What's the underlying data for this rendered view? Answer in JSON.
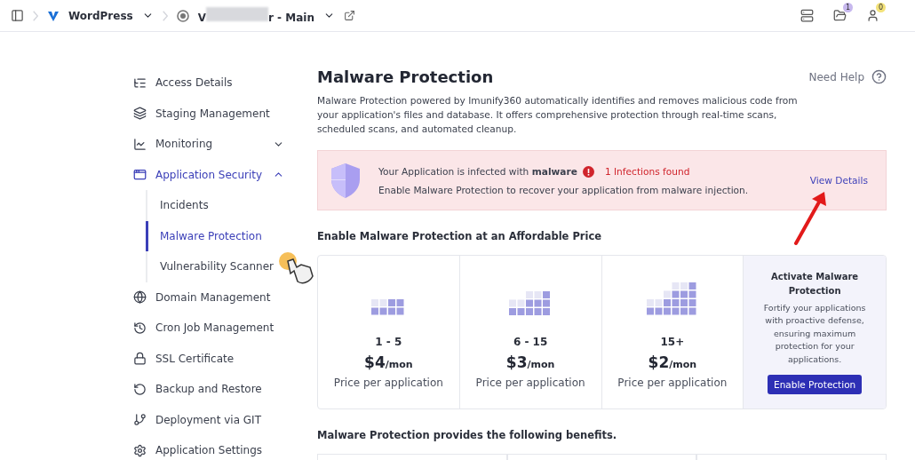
{
  "topbar": {
    "breadcrumbs": [
      {
        "label": "WordPress"
      },
      {
        "label_start": "V",
        "label_end": "r - Main"
      }
    ],
    "notifications": [
      {
        "count": "1",
        "color": "#c7b8ee"
      },
      {
        "count": "0",
        "color": "#f3e27a"
      }
    ]
  },
  "sidebar": {
    "items": [
      {
        "label": "Access Details",
        "kind": "item"
      },
      {
        "label": "Staging Management",
        "kind": "item"
      },
      {
        "label": "Monitoring",
        "kind": "group",
        "expanded": false
      },
      {
        "label": "Application Security",
        "kind": "group",
        "expanded": true,
        "children": [
          {
            "label": "Incidents",
            "selected": false
          },
          {
            "label": "Malware Protection",
            "selected": true
          },
          {
            "label": "Vulnerability Scanner",
            "selected": false
          }
        ]
      },
      {
        "label": "Domain Management",
        "kind": "item"
      },
      {
        "label": "Cron Job Management",
        "kind": "item"
      },
      {
        "label": "SSL Certificate",
        "kind": "item"
      },
      {
        "label": "Backup and Restore",
        "kind": "item"
      },
      {
        "label": "Deployment via GIT",
        "kind": "item"
      },
      {
        "label": "Application Settings",
        "kind": "item"
      }
    ]
  },
  "page": {
    "title": "Malware Protection",
    "help": "Need Help",
    "description": "Malware Protection powered by Imunify360 automatically identifies and removes malicious code from your application's files and database. It offers comprehensive protection through real-time scans, scheduled scans, and automated cleanup."
  },
  "alert": {
    "message": "Your Application is infected with **malware**",
    "infections": "1 Infections found",
    "detail": "Enable Malware Protection to recover your application from malware injection.",
    "link": "View Details"
  },
  "pricing": {
    "heading": "Enable Malware Protection at an Affordable Price",
    "tiers": [
      {
        "range": "1 - 5",
        "price": "$4",
        "unit": "/mon",
        "note": "Price per application"
      },
      {
        "range": "6 - 15",
        "price": "$3",
        "unit": "/mon",
        "note": "Price per application"
      },
      {
        "range": "15+",
        "price": "$2",
        "unit": "/mon",
        "note": "Price per application"
      }
    ],
    "activate": {
      "title": "Activate Malware Protection",
      "text": "Fortify your applications with proactive defense, ensuring maximum protection for your applications.",
      "button": "Enable Protection"
    }
  },
  "benefits": {
    "heading": "Malware Protection provides the following benefits."
  }
}
